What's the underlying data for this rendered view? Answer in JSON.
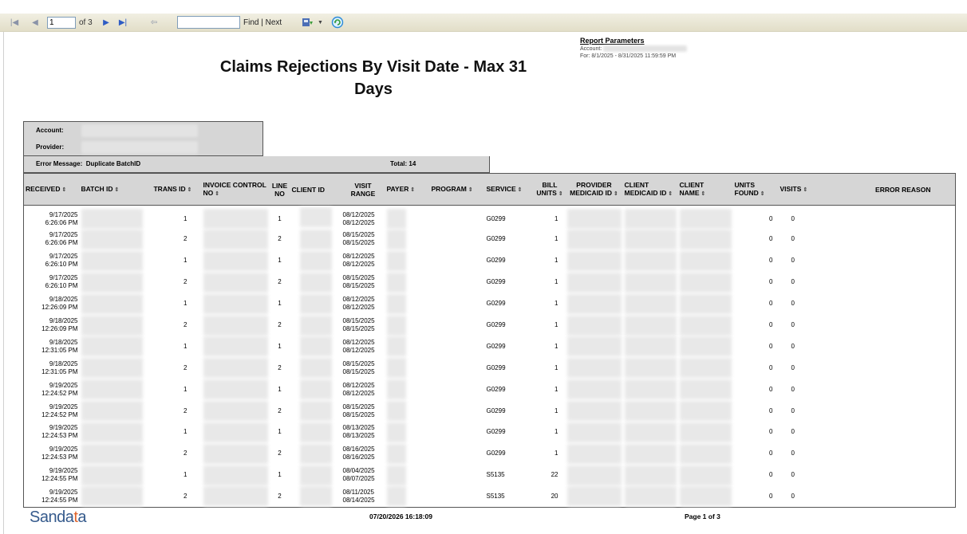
{
  "toolbar": {
    "page_value": "1",
    "page_of": "of 3",
    "find_label": "Find",
    "separator": "|",
    "next_label": "Next",
    "icons": [
      "first-page-icon",
      "prev-page-icon",
      "next-page-icon",
      "last-page-icon",
      "back-icon",
      "export-icon",
      "refresh-icon"
    ]
  },
  "params": {
    "heading": "Report Parameters",
    "account_label": "Account:",
    "for_line": "For: 8/1/2025 - 8/31/2025 11:59:59 PM"
  },
  "report": {
    "title_line1": "Claims Rejections By Visit Date - Max 31",
    "title_line2": "Days"
  },
  "info": {
    "account_label": "Account:",
    "provider_label": "Provider:",
    "error_message_label": "Error Message:",
    "error_message_value": "Duplicate BatchID",
    "total_label": "Total: 14"
  },
  "columns": [
    {
      "label": "RECEIVED",
      "sort": "⇕"
    },
    {
      "label": "BATCH ID",
      "sort": "⇕"
    },
    {
      "label": "TRANS ID",
      "sort": "⇕"
    },
    {
      "label": "INVOICE CONTROL NO",
      "sort": "⇕"
    },
    {
      "label": "LINE NO",
      "sort": ""
    },
    {
      "label": "CLIENT ID",
      "sort": ""
    },
    {
      "label": "VISIT RANGE",
      "sort": ""
    },
    {
      "label": "PAYER",
      "sort": "⇕"
    },
    {
      "label": "PROGRAM",
      "sort": "⇕"
    },
    {
      "label": "SERVICE",
      "sort": "⇕"
    },
    {
      "label": "BILL UNITS",
      "sort": "⇕"
    },
    {
      "label": "PROVIDER MEDICAID ID",
      "sort": "⇕"
    },
    {
      "label": "CLIENT MEDICAID ID",
      "sort": "⇕"
    },
    {
      "label": "CLIENT NAME",
      "sort": "⇕"
    },
    {
      "label": "UNITS FOUND",
      "sort": "⇕"
    },
    {
      "label": "VISITS",
      "sort": "⇕"
    },
    {
      "label": "ERROR REASON",
      "sort": ""
    }
  ],
  "rows": [
    {
      "received_date": "9/17/2025",
      "received_time": "6:26:06 PM",
      "trans_id": "1",
      "line_no": "1",
      "visit_start": "08/12/2025",
      "visit_end": "08/12/2025",
      "service": "G0299",
      "bill_units": "1",
      "units_found": "0",
      "visits": "0"
    },
    {
      "received_date": "9/17/2025",
      "received_time": "6:26:06 PM",
      "trans_id": "2",
      "line_no": "2",
      "visit_start": "08/15/2025",
      "visit_end": "08/15/2025",
      "service": "G0299",
      "bill_units": "1",
      "units_found": "0",
      "visits": "0"
    },
    {
      "received_date": "9/17/2025",
      "received_time": "6:26:10 PM",
      "trans_id": "1",
      "line_no": "1",
      "visit_start": "08/12/2025",
      "visit_end": "08/12/2025",
      "service": "G0299",
      "bill_units": "1",
      "units_found": "0",
      "visits": "0"
    },
    {
      "received_date": "9/17/2025",
      "received_time": "6:26:10 PM",
      "trans_id": "2",
      "line_no": "2",
      "visit_start": "08/15/2025",
      "visit_end": "08/15/2025",
      "service": "G0299",
      "bill_units": "1",
      "units_found": "0",
      "visits": "0"
    },
    {
      "received_date": "9/18/2025",
      "received_time": "12:26:09 PM",
      "trans_id": "1",
      "line_no": "1",
      "visit_start": "08/12/2025",
      "visit_end": "08/12/2025",
      "service": "G0299",
      "bill_units": "1",
      "units_found": "0",
      "visits": "0"
    },
    {
      "received_date": "9/18/2025",
      "received_time": "12:26:09 PM",
      "trans_id": "2",
      "line_no": "2",
      "visit_start": "08/15/2025",
      "visit_end": "08/15/2025",
      "service": "G0299",
      "bill_units": "1",
      "units_found": "0",
      "visits": "0"
    },
    {
      "received_date": "9/18/2025",
      "received_time": "12:31:05 PM",
      "trans_id": "1",
      "line_no": "1",
      "visit_start": "08/12/2025",
      "visit_end": "08/12/2025",
      "service": "G0299",
      "bill_units": "1",
      "units_found": "0",
      "visits": "0"
    },
    {
      "received_date": "9/18/2025",
      "received_time": "12:31:05 PM",
      "trans_id": "2",
      "line_no": "2",
      "visit_start": "08/15/2025",
      "visit_end": "08/15/2025",
      "service": "G0299",
      "bill_units": "1",
      "units_found": "0",
      "visits": "0"
    },
    {
      "received_date": "9/19/2025",
      "received_time": "12:24:52 PM",
      "trans_id": "1",
      "line_no": "1",
      "visit_start": "08/12/2025",
      "visit_end": "08/12/2025",
      "service": "G0299",
      "bill_units": "1",
      "units_found": "0",
      "visits": "0"
    },
    {
      "received_date": "9/19/2025",
      "received_time": "12:24:52 PM",
      "trans_id": "2",
      "line_no": "2",
      "visit_start": "08/15/2025",
      "visit_end": "08/15/2025",
      "service": "G0299",
      "bill_units": "1",
      "units_found": "0",
      "visits": "0"
    },
    {
      "received_date": "9/19/2025",
      "received_time": "12:24:53 PM",
      "trans_id": "1",
      "line_no": "1",
      "visit_start": "08/13/2025",
      "visit_end": "08/13/2025",
      "service": "G0299",
      "bill_units": "1",
      "units_found": "0",
      "visits": "0"
    },
    {
      "received_date": "9/19/2025",
      "received_time": "12:24:53 PM",
      "trans_id": "2",
      "line_no": "2",
      "visit_start": "08/16/2025",
      "visit_end": "08/16/2025",
      "service": "G0299",
      "bill_units": "1",
      "units_found": "0",
      "visits": "0"
    },
    {
      "received_date": "9/19/2025",
      "received_time": "12:24:55 PM",
      "trans_id": "1",
      "line_no": "1",
      "visit_start": "08/04/2025",
      "visit_end": "08/07/2025",
      "service": "S5135",
      "bill_units": "22",
      "units_found": "0",
      "visits": "0"
    },
    {
      "received_date": "9/19/2025",
      "received_time": "12:24:55 PM",
      "trans_id": "2",
      "line_no": "2",
      "visit_start": "08/11/2025",
      "visit_end": "08/14/2025",
      "service": "S5135",
      "bill_units": "20",
      "units_found": "0",
      "visits": "0"
    }
  ],
  "footer": {
    "logo_pre": "Sanda",
    "logo_accent": "t",
    "logo_post": "a",
    "timestamp": "07/20/2026 16:18:09",
    "page_label": "Page 1 of 3"
  },
  "colors": {
    "toolbar_bg": "#ece9d8",
    "header_bg": "#d6d6d6",
    "logo_blue": "#355a8c",
    "logo_orange": "#e0632a",
    "nav_blue": "#2e5cc4"
  }
}
